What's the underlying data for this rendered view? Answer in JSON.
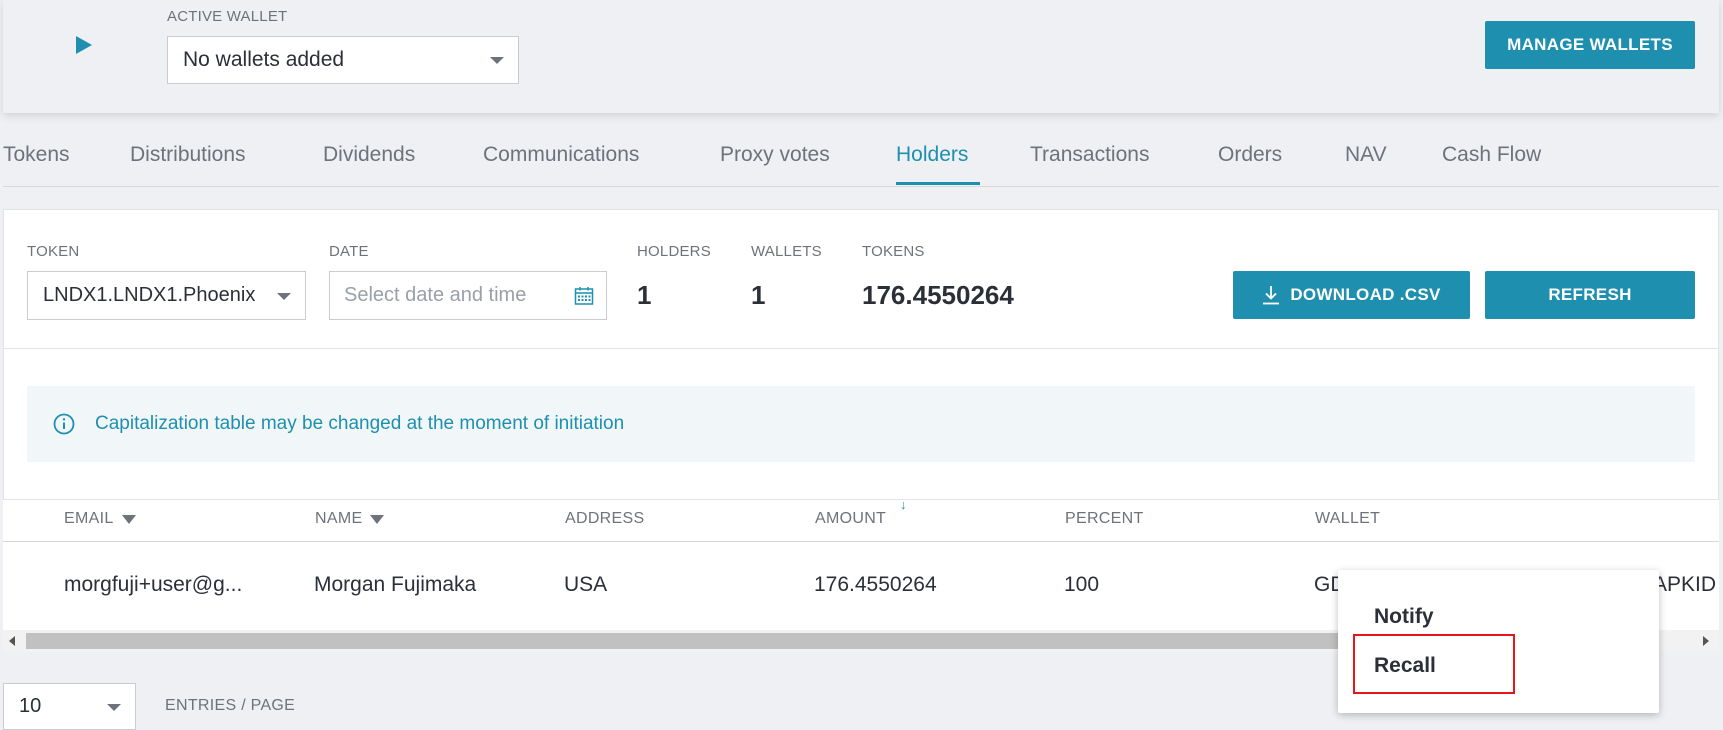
{
  "wallet": {
    "label": "ACTIVE WALLET",
    "selected": "No wallets added",
    "manage_button": "MANAGE WALLETS"
  },
  "tabs": [
    {
      "label": "Tokens"
    },
    {
      "label": "Distributions"
    },
    {
      "label": "Dividends"
    },
    {
      "label": "Communications"
    },
    {
      "label": "Proxy votes"
    },
    {
      "label": "Holders",
      "active": true
    },
    {
      "label": "Transactions"
    },
    {
      "label": "Orders"
    },
    {
      "label": "NAV"
    },
    {
      "label": "Cash Flow"
    }
  ],
  "filters": {
    "token_label": "TOKEN",
    "token_value": "LNDX1.LNDX1.Phoenix",
    "date_label": "DATE",
    "date_placeholder": "Select date and time"
  },
  "stats": {
    "holders_label": "HOLDERS",
    "holders_value": "1",
    "wallets_label": "WALLETS",
    "wallets_value": "1",
    "tokens_label": "TOKENS",
    "tokens_value": "176.4550264"
  },
  "actions": {
    "download": "DOWNLOAD .CSV",
    "refresh": "REFRESH"
  },
  "notice": "Capitalization table may be changed at the moment of initiation",
  "table": {
    "columns": [
      "EMAIL",
      "NAME",
      "ADDRESS",
      "AMOUNT",
      "PERCENT",
      "WALLET"
    ],
    "sort_indicator": "↓",
    "rows": [
      {
        "email": "morgfuji+user@g...",
        "name": "Morgan Fujimaka",
        "address": "USA",
        "amount": "176.4550264",
        "percent": "100",
        "wallet_start": "GD",
        "wallet_end": "APKID"
      }
    ]
  },
  "pagination": {
    "page_size": "10",
    "label": "ENTRIES / PAGE"
  },
  "context_menu": {
    "items": [
      "Notify",
      "Recall"
    ],
    "highlighted": "Recall"
  },
  "colors": {
    "accent": "#1f8fb0",
    "highlight": "#e8161c",
    "background": "#eef0f3"
  }
}
